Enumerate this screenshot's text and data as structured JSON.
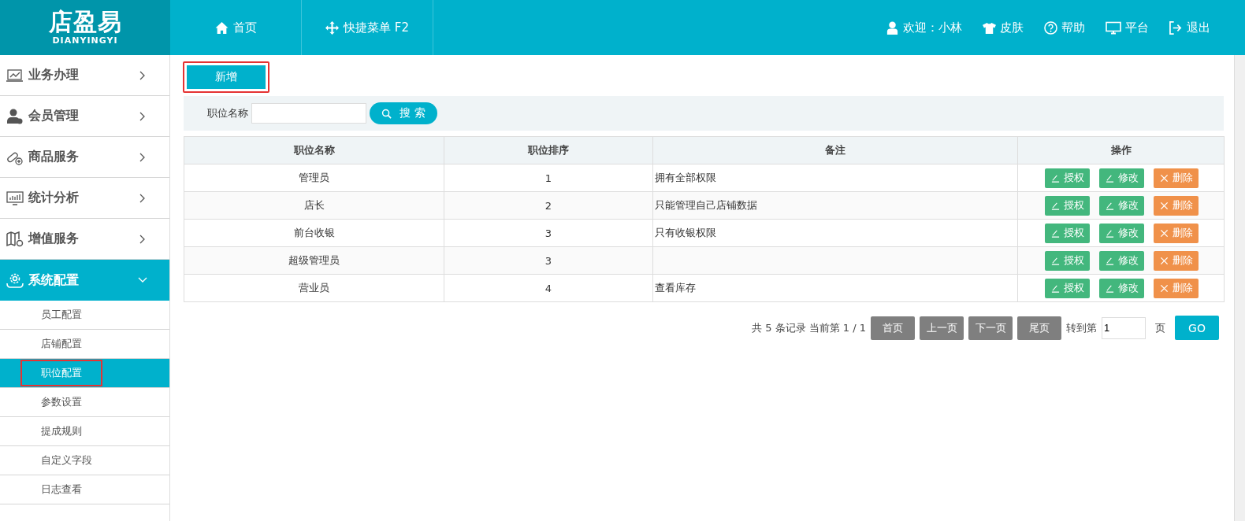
{
  "logo": {
    "name": "店盈易",
    "subtitle": "DIANYINGYI"
  },
  "top_nav": [
    {
      "label": "首页"
    },
    {
      "label": "快捷菜单 F2"
    }
  ],
  "user_menu": [
    {
      "label": "欢迎：小林"
    },
    {
      "label": "皮肤"
    },
    {
      "label": "帮助"
    },
    {
      "label": "平台"
    },
    {
      "label": "退出"
    }
  ],
  "sidebar": {
    "items": [
      {
        "label": "业务办理",
        "expanded": false
      },
      {
        "label": "会员管理",
        "expanded": false
      },
      {
        "label": "商品服务",
        "expanded": false
      },
      {
        "label": "统计分析",
        "expanded": false
      },
      {
        "label": "增值服务",
        "expanded": false
      },
      {
        "label": "系统配置",
        "expanded": true,
        "children": [
          {
            "label": "员工配置",
            "selected": false,
            "highlighted": false
          },
          {
            "label": "店铺配置",
            "selected": false,
            "highlighted": false
          },
          {
            "label": "职位配置",
            "selected": true,
            "highlighted": true
          },
          {
            "label": "参数设置",
            "selected": false,
            "highlighted": false
          },
          {
            "label": "提成规则",
            "selected": false,
            "highlighted": false
          },
          {
            "label": "自定义字段",
            "selected": false,
            "highlighted": false
          },
          {
            "label": "日志查看",
            "selected": false,
            "highlighted": false
          }
        ]
      }
    ]
  },
  "add_button": {
    "label": "新增",
    "highlighted": true
  },
  "search": {
    "label": "职位名称",
    "button": "搜 索"
  },
  "table": {
    "columns": [
      "职位名称",
      "职位排序",
      "备注",
      "操作"
    ],
    "rows": [
      {
        "name": "管理员",
        "order": "1",
        "note": "拥有全部权限",
        "actions": [
          {
            "label": "授权",
            "kind": "edit"
          },
          {
            "label": "修改",
            "kind": "edit"
          },
          {
            "label": "删除",
            "kind": "delete"
          }
        ]
      },
      {
        "name": "店长",
        "order": "2",
        "note": "只能管理自己店铺数据",
        "actions": [
          {
            "label": "授权",
            "kind": "edit"
          },
          {
            "label": "修改",
            "kind": "edit"
          },
          {
            "label": "删除",
            "kind": "delete"
          }
        ]
      },
      {
        "name": "前台收银",
        "order": "3",
        "note": "只有收银权限",
        "actions": [
          {
            "label": "授权",
            "kind": "edit"
          },
          {
            "label": "修改",
            "kind": "edit"
          },
          {
            "label": "删除",
            "kind": "delete"
          }
        ]
      },
      {
        "name": "超级管理员",
        "order": "3",
        "note": "",
        "actions": [
          {
            "label": "授权",
            "kind": "edit"
          },
          {
            "label": "修改",
            "kind": "edit"
          },
          {
            "label": "删除",
            "kind": "delete"
          }
        ]
      },
      {
        "name": "营业员",
        "order": "4",
        "note": "查看库存",
        "actions": [
          {
            "label": "授权",
            "kind": "edit"
          },
          {
            "label": "修改",
            "kind": "edit"
          },
          {
            "label": "删除",
            "kind": "delete"
          }
        ]
      }
    ]
  },
  "pagination": {
    "summary": "共 5 条记录 当前第 1 / 1",
    "buttons": [
      "首页",
      "上一页",
      "下一页",
      "尾页"
    ],
    "goto_label": "转到第",
    "page_value": "1",
    "page_unit": "页",
    "go": "GO"
  }
}
